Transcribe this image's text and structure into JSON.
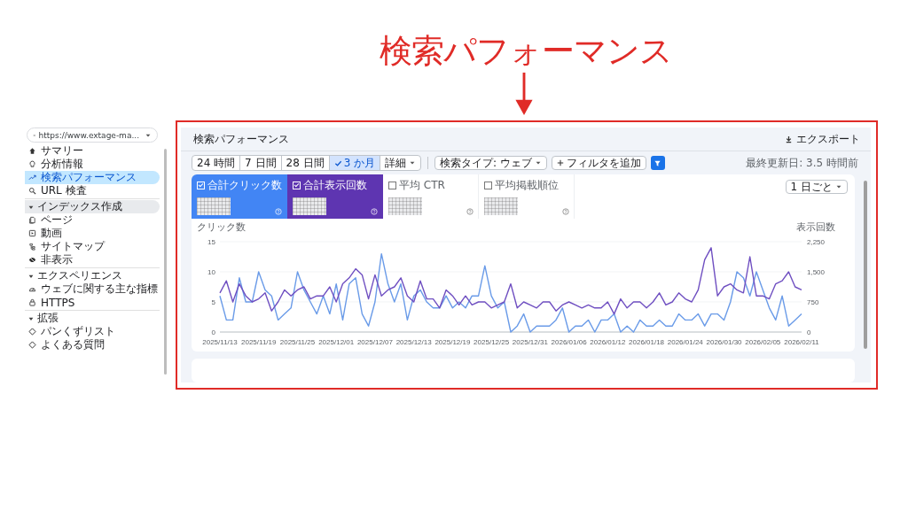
{
  "annotation": {
    "label": "検索パフォーマンス"
  },
  "sidebar": {
    "property": "https://www.extage-ma...",
    "top_items": [
      {
        "label": "サマリー",
        "selected": false
      },
      {
        "label": "分析情報",
        "selected": false
      },
      {
        "label": "検索パフォーマンス",
        "selected": true
      },
      {
        "label": "URL 検査",
        "selected": false
      }
    ],
    "sections": [
      {
        "title": "インデックス作成",
        "expanded": true,
        "highlighted": true,
        "items": [
          "ページ",
          "動画",
          "サイトマップ",
          "非表示"
        ]
      },
      {
        "title": "エクスペリエンス",
        "expanded": true,
        "highlighted": false,
        "items": [
          "ウェブに関する主な指標",
          "HTTPS"
        ]
      },
      {
        "title": "拡張",
        "expanded": true,
        "highlighted": false,
        "items": [
          "パンくずリスト",
          "よくある質問"
        ]
      }
    ]
  },
  "header": {
    "title": "検索パフォーマンス",
    "export": "エクスポート"
  },
  "date_ranges": [
    {
      "label": "24 時間",
      "selected": false
    },
    {
      "label": "7 日間",
      "selected": false
    },
    {
      "label": "28 日間",
      "selected": false
    },
    {
      "label": "3 か月",
      "selected": true
    },
    {
      "label": "詳細",
      "selected": false
    }
  ],
  "search_type": "検索タイプ: ウェブ",
  "add_filter": "フィルタを追加",
  "last_updated": "最終更新日: 3.5 時間前",
  "metrics": [
    {
      "label": "合計クリック数",
      "checked": true,
      "color": "#4285f4"
    },
    {
      "label": "合計表示回数",
      "checked": true,
      "color": "#5e35b1"
    },
    {
      "label": "平均 CTR",
      "checked": false
    },
    {
      "label": "平均掲載順位",
      "checked": false
    }
  ],
  "granularity": "1 日ごと",
  "chart_data": {
    "type": "line",
    "ylabel": "クリック数",
    "y2label": "表示回数",
    "categories": [
      "2025/11/13",
      null,
      null,
      null,
      null,
      null,
      "2025/11/19",
      null,
      null,
      null,
      null,
      null,
      "2025/11/25",
      null,
      null,
      null,
      null,
      null,
      "2025/12/01",
      null,
      null,
      null,
      null,
      null,
      "2025/12/07",
      null,
      null,
      null,
      null,
      null,
      "2025/12/13",
      null,
      null,
      null,
      null,
      null,
      "2025/12/19",
      null,
      null,
      null,
      null,
      null,
      "2025/12/25",
      null,
      null,
      null,
      null,
      null,
      "2025/12/31",
      null,
      null,
      null,
      null,
      null,
      "2026/01/06",
      null,
      null,
      null,
      null,
      null,
      "2026/01/12",
      null,
      null,
      null,
      null,
      null,
      "2026/01/18",
      null,
      null,
      null,
      null,
      null,
      "2026/01/24",
      null,
      null,
      null,
      null,
      null,
      "2026/01/30",
      null,
      null,
      null,
      null,
      null,
      "2026/02/05",
      null,
      null,
      null,
      null,
      null,
      "2026/02/11"
    ],
    "ylim": [
      0,
      15
    ],
    "y2lim": [
      0,
      2250
    ],
    "yticks": [
      0,
      5,
      10,
      15
    ],
    "y2ticks": [
      {
        "value": 0,
        "label": "0"
      },
      {
        "value": 750,
        "label": "750"
      },
      {
        "value": 1500,
        "label": "1,500"
      },
      {
        "value": 2250,
        "label": "2,250"
      }
    ],
    "series": [
      {
        "color": "#6a9be8",
        "values": [
          6,
          2,
          2,
          9,
          5,
          5,
          10,
          7,
          6,
          2,
          3,
          4,
          10,
          7,
          5,
          3,
          6,
          3,
          8,
          2,
          8,
          9,
          3,
          1,
          5,
          13,
          8,
          5,
          8,
          2,
          6,
          7,
          5,
          4,
          4,
          6,
          4,
          5,
          4,
          6,
          6,
          11,
          6,
          4,
          5,
          0,
          1,
          3,
          0,
          1,
          1,
          1,
          2,
          4,
          0,
          1,
          1,
          2,
          0,
          2,
          2,
          3,
          0,
          1,
          0,
          2,
          1,
          1,
          2,
          1,
          1,
          3,
          2,
          2,
          3,
          1,
          3,
          3,
          2,
          5,
          10,
          9,
          6,
          10,
          7,
          4,
          2,
          6,
          1,
          2,
          3
        ]
      },
      {
        "color": "#6f4fc1",
        "axis": "y2",
        "values": [
          975,
          1275,
          750,
          1200,
          900,
          750,
          825,
          975,
          525,
          750,
          1050,
          900,
          1050,
          1125,
          825,
          900,
          900,
          1125,
          750,
          1200,
          1350,
          1575,
          1425,
          825,
          1425,
          900,
          1050,
          1125,
          1350,
          900,
          750,
          1275,
          825,
          825,
          600,
          1050,
          900,
          675,
          900,
          675,
          750,
          750,
          600,
          675,
          750,
          1200,
          600,
          750,
          675,
          600,
          750,
          750,
          525,
          675,
          750,
          675,
          600,
          675,
          600,
          600,
          750,
          450,
          825,
          600,
          750,
          750,
          600,
          750,
          975,
          675,
          750,
          975,
          825,
          750,
          1050,
          1800,
          2100,
          900,
          1125,
          1200,
          1050,
          975,
          1875,
          900,
          900,
          825,
          1200,
          1275,
          1500,
          1125,
          1050
        ]
      }
    ]
  }
}
